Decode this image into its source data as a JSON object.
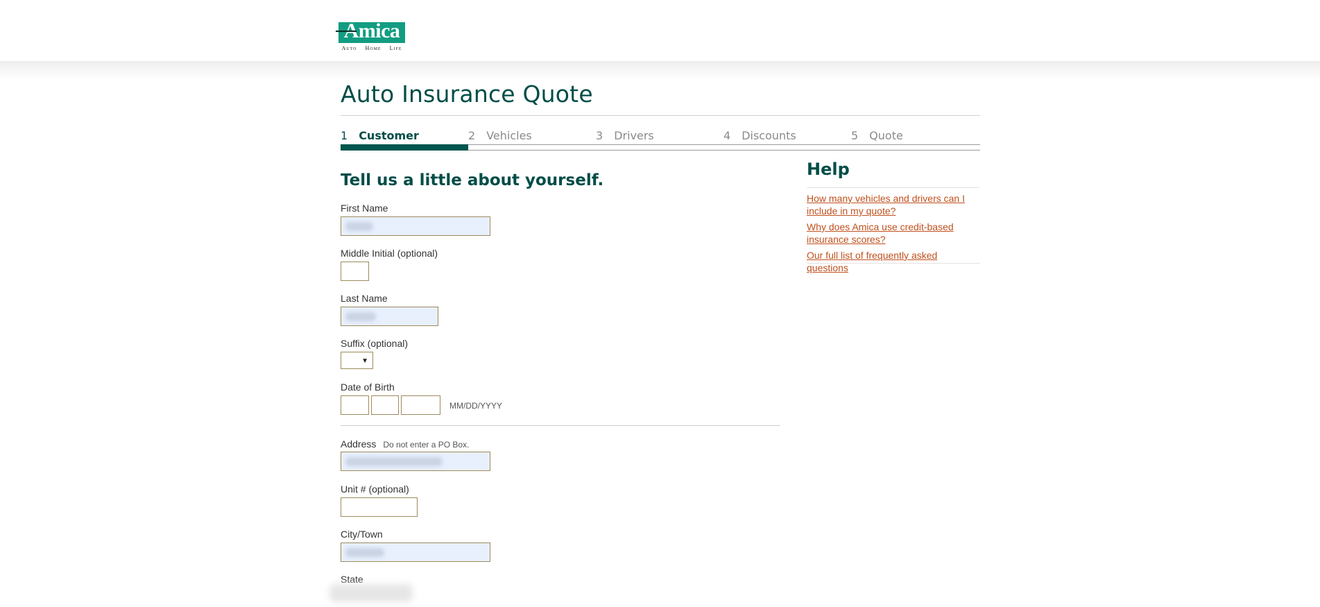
{
  "brand": {
    "logo_text": "Amica",
    "tagline": [
      "Auto",
      "Home",
      "Life"
    ],
    "colors": {
      "brand_green": "#129d82",
      "title_teal": "#004d47",
      "link": "#c0501d",
      "field_border": "#9c8a5c"
    }
  },
  "page": {
    "title": "Auto Insurance Quote"
  },
  "steps": [
    {
      "num": "1",
      "label": "Customer",
      "active": true
    },
    {
      "num": "2",
      "label": "Vehicles",
      "active": false
    },
    {
      "num": "3",
      "label": "Drivers",
      "active": false
    },
    {
      "num": "4",
      "label": "Discounts",
      "active": false
    },
    {
      "num": "5",
      "label": "Quote",
      "active": false
    }
  ],
  "progress": {
    "current_step": 1,
    "total_steps": 5
  },
  "form": {
    "heading": "Tell us a little about yourself.",
    "first_name": {
      "label": "First Name",
      "value": ""
    },
    "middle_initial": {
      "label": "Middle Initial (optional)",
      "value": ""
    },
    "last_name": {
      "label": "Last Name",
      "value": ""
    },
    "suffix": {
      "label": "Suffix (optional)",
      "selected": ""
    },
    "dob": {
      "label": "Date of Birth",
      "format_hint": "MM/DD/YYYY"
    },
    "address": {
      "label": "Address",
      "hint": "Do not enter a PO Box.",
      "value": ""
    },
    "unit": {
      "label": "Unit # (optional)",
      "value": ""
    },
    "city": {
      "label": "City/Town",
      "value": ""
    },
    "state": {
      "label": "State"
    }
  },
  "help": {
    "title": "Help",
    "links": [
      "How many vehicles and drivers can I include in my quote?",
      "Why does Amica use credit-based insurance scores?",
      "Our full list of frequently asked questions"
    ]
  }
}
